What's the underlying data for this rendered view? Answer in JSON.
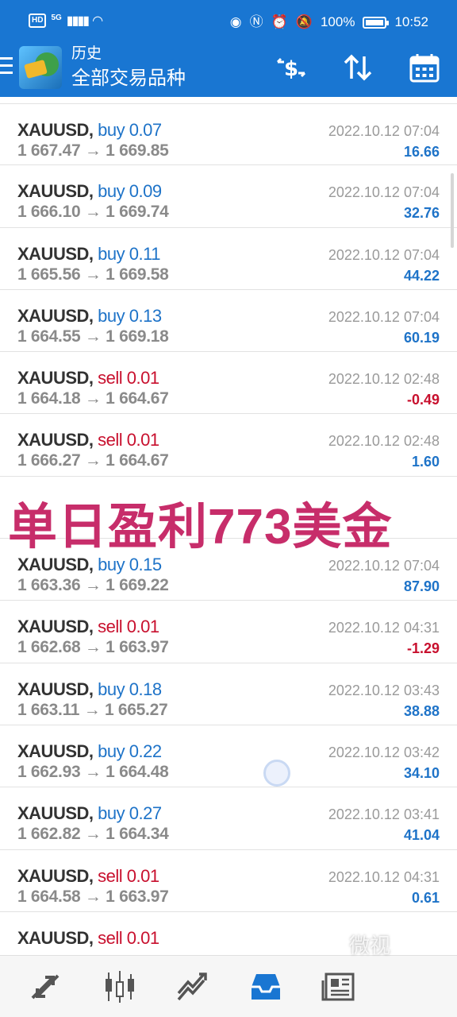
{
  "status_bar": {
    "hd": "HD",
    "network": "5G",
    "battery": "100%",
    "time": "10:52"
  },
  "header": {
    "subtitle": "历史",
    "title": "全部交易品种",
    "icons": [
      "currency-exchange-icon",
      "sort-icon",
      "calendar-icon"
    ]
  },
  "trades": [
    {
      "symbol": "XAUUSD,",
      "side": "buy",
      "volume": "0.07",
      "open": "1 667.47",
      "close": "1 669.85",
      "arrow": "→",
      "date": "2022.10.12 07:04",
      "profit": "16.66"
    },
    {
      "symbol": "XAUUSD,",
      "side": "buy",
      "volume": "0.09",
      "open": "1 666.10",
      "close": "1 669.74",
      "arrow": "→",
      "date": "2022.10.12 07:04",
      "profit": "32.76"
    },
    {
      "symbol": "XAUUSD,",
      "side": "buy",
      "volume": "0.11",
      "open": "1 665.56",
      "close": "1 669.58",
      "arrow": "→",
      "date": "2022.10.12 07:04",
      "profit": "44.22"
    },
    {
      "symbol": "XAUUSD,",
      "side": "buy",
      "volume": "0.13",
      "open": "1 664.55",
      "close": "1 669.18",
      "arrow": "→",
      "date": "2022.10.12 07:04",
      "profit": "60.19"
    },
    {
      "symbol": "XAUUSD,",
      "side": "sell",
      "volume": "0.01",
      "open": "1 664.18",
      "close": "1 664.67",
      "arrow": "→",
      "date": "2022.10.12 02:48",
      "profit": "-0.49"
    },
    {
      "symbol": "XAUUSD,",
      "side": "sell",
      "volume": "0.01",
      "open": "1 666.27",
      "close": "1 664.67",
      "arrow": "→",
      "date": "2022.10.12 02:48",
      "profit": "1.60"
    },
    {
      "symbol": "",
      "side": "",
      "volume": "",
      "open": "",
      "close": "",
      "arrow": "",
      "date": "",
      "profit": ""
    },
    {
      "symbol": "XAUUSD,",
      "side": "buy",
      "volume": "0.15",
      "open": "1 663.36",
      "close": "1 669.22",
      "arrow": "→",
      "date": "2022.10.12 07:04",
      "profit": "87.90"
    },
    {
      "symbol": "XAUUSD,",
      "side": "sell",
      "volume": "0.01",
      "open": "1 662.68",
      "close": "1 663.97",
      "arrow": "→",
      "date": "2022.10.12 04:31",
      "profit": "-1.29"
    },
    {
      "symbol": "XAUUSD,",
      "side": "buy",
      "volume": "0.18",
      "open": "1 663.11",
      "close": "1 665.27",
      "arrow": "→",
      "date": "2022.10.12 03:43",
      "profit": "38.88"
    },
    {
      "symbol": "XAUUSD,",
      "side": "buy",
      "volume": "0.22",
      "open": "1 662.93",
      "close": "1 664.48",
      "arrow": "→",
      "date": "2022.10.12 03:42",
      "profit": "34.10"
    },
    {
      "symbol": "XAUUSD,",
      "side": "buy",
      "volume": "0.27",
      "open": "1 662.82",
      "close": "1 664.34",
      "arrow": "→",
      "date": "2022.10.12 03:41",
      "profit": "41.04"
    },
    {
      "symbol": "XAUUSD,",
      "side": "sell",
      "volume": "0.01",
      "open": "1 664.58",
      "close": "1 663.97",
      "arrow": "→",
      "date": "2022.10.12 04:31",
      "profit": "0.61"
    },
    {
      "symbol": "XAUUSD,",
      "side": "sell",
      "volume": "0.01",
      "open": "",
      "close": "",
      "arrow": "",
      "date": "",
      "profit": ""
    }
  ],
  "overlay_text": "单日盈利773美金",
  "watermark": "微视",
  "bottom_nav": [
    "quotes-icon",
    "chart-icon",
    "trade-icon",
    "history-icon",
    "news-icon"
  ],
  "colors": {
    "accent": "#1976d2",
    "buy": "#1e73c8",
    "sell": "#c8102e",
    "overlay": "#c72d6a"
  }
}
